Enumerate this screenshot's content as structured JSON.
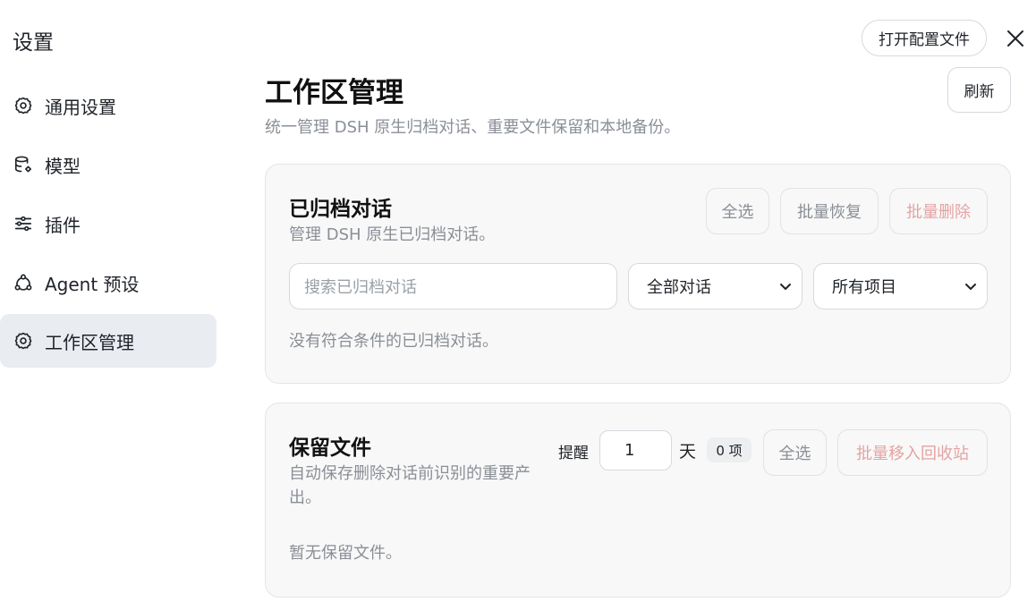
{
  "sidebar": {
    "title": "设置",
    "items": [
      {
        "label": "通用设置",
        "icon": "gear-icon"
      },
      {
        "label": "模型",
        "icon": "database-gear-icon"
      },
      {
        "label": "插件",
        "icon": "sliders-icon"
      },
      {
        "label": "Agent 预设",
        "icon": "agent-nodes-icon"
      },
      {
        "label": "工作区管理",
        "icon": "gear-icon",
        "active": true
      }
    ]
  },
  "header": {
    "open_config_label": "打开配置文件",
    "title": "工作区管理",
    "subtitle": "统一管理 DSH 原生归档对话、重要文件保留和本地备份。",
    "refresh_label": "刷新"
  },
  "archived": {
    "title": "已归档对话",
    "description": "管理 DSH 原生已归档对话。",
    "select_all_label": "全选",
    "restore_label": "批量恢复",
    "delete_label": "批量删除",
    "search_placeholder": "搜索已归档对话",
    "filter_conversations": "全部对话",
    "filter_projects": "所有项目",
    "empty_text": "没有符合条件的已归档对话。"
  },
  "retained": {
    "title": "保留文件",
    "description": "自动保存删除对话前识别的重要产出。",
    "remind_label": "提醒",
    "days_value": "1",
    "days_unit": "天",
    "count_badge": "0 项",
    "select_all_label": "全选",
    "move_to_trash_label": "批量移入回收站",
    "empty_text": "暂无保留文件。"
  },
  "colors": {
    "active_nav_bg": "#e9edf2",
    "danger_text": "#e5a3a3",
    "muted_text": "#8a8f96",
    "card_bg": "#f8f8f8"
  }
}
